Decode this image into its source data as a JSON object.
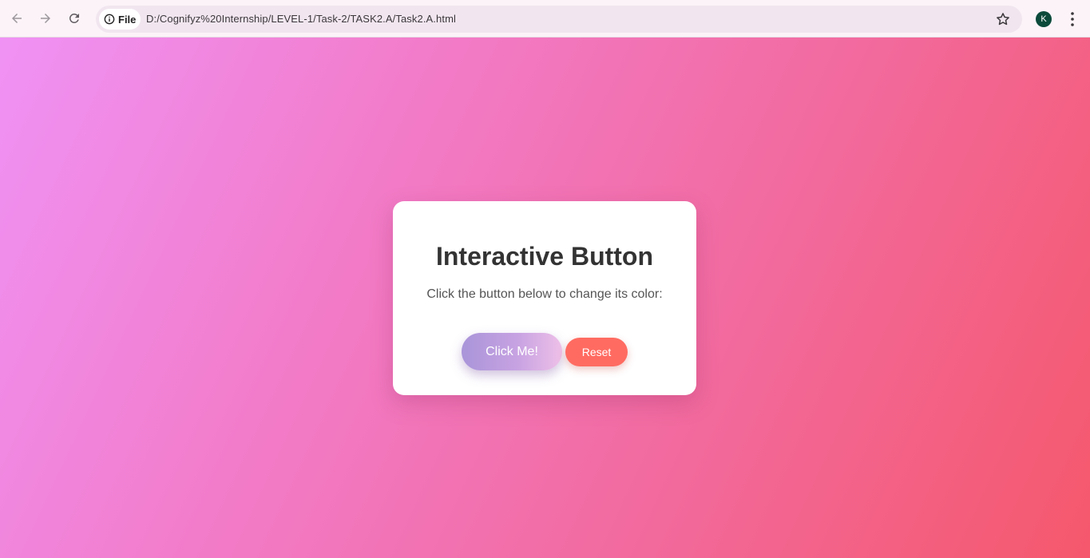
{
  "browser": {
    "site_chip_label": "File",
    "url": "D:/Cognifyz%20Internship/LEVEL-1/Task-2/TASK2.A/Task2.A.html",
    "profile_initial": "K"
  },
  "colors": {
    "background_gradient": [
      "#f092f5",
      "#f27ac6",
      "#f26a9e",
      "#f5586c"
    ],
    "card": "#ffffff",
    "reset_button": "#ff6b61",
    "click_button_gradient": [
      "#a995d9",
      "#eec0e8"
    ]
  },
  "card": {
    "title": "Interactive Button",
    "description": "Click the button below to change its color:",
    "click_button_label": "Click Me!",
    "reset_button_label": "Reset"
  }
}
